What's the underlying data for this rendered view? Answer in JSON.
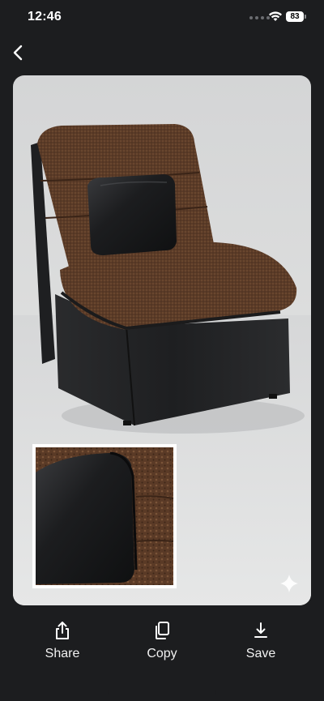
{
  "status_bar": {
    "time": "12:46",
    "battery": "83"
  },
  "navigation": {
    "back_icon": "chevron-left-icon"
  },
  "photo": {
    "subject": "brown fabric lounge chair with black leather lumbar cushion",
    "inset": "close-up of cushion",
    "badge_icon": "sparkle-icon"
  },
  "actions": [
    {
      "label": "Share",
      "icon": "share-icon"
    },
    {
      "label": "Copy",
      "icon": "copy-icon"
    },
    {
      "label": "Save",
      "icon": "download-icon"
    }
  ],
  "colors": {
    "background": "#1c1d1f",
    "photo_backdrop": "#d9dadb",
    "fabric": "#5a3a26",
    "leather": "#1f2022"
  }
}
